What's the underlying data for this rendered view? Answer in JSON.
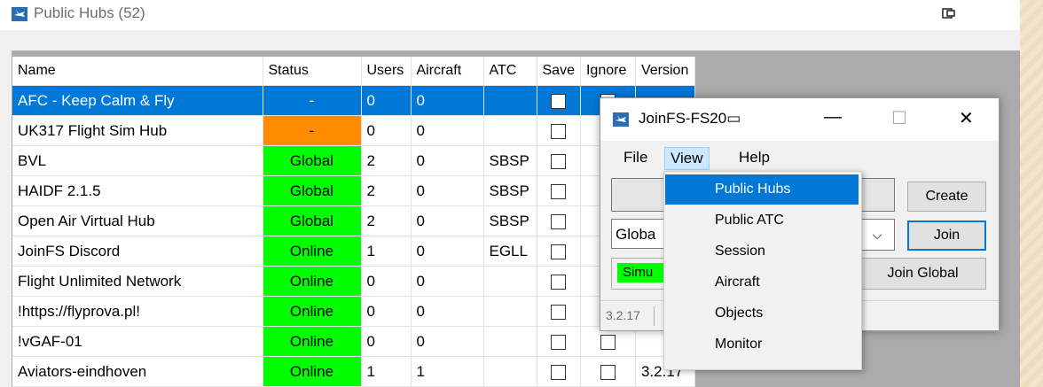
{
  "window": {
    "title": "Public Hubs (52)",
    "icon": "joinfs-plane-icon",
    "restore_icon": "restore-icon"
  },
  "grid": {
    "columns": [
      "Name",
      "Status",
      "Users",
      "Aircraft",
      "ATC",
      "Save",
      "Ignore",
      "Version"
    ],
    "rows": [
      {
        "name": "AFC - Keep Calm & Fly",
        "status": "-",
        "users": "0",
        "aircraft": "0",
        "atc": "",
        "version": "",
        "selected": true,
        "status_color": "selected"
      },
      {
        "name": "UK317 Flight Sim Hub",
        "status": "-",
        "users": "0",
        "aircraft": "0",
        "atc": "",
        "version": "",
        "selected": false,
        "status_color": "#ff8c00"
      },
      {
        "name": "BVL",
        "status": "Global",
        "users": "2",
        "aircraft": "0",
        "atc": "SBSP",
        "version": "",
        "selected": false,
        "status_color": "#00ff00"
      },
      {
        "name": "HAIDF 2.1.5",
        "status": "Global",
        "users": "2",
        "aircraft": "0",
        "atc": "SBSP",
        "version": "",
        "selected": false,
        "status_color": "#00ff00"
      },
      {
        "name": "Open Air Virtual Hub",
        "status": "Global",
        "users": "2",
        "aircraft": "0",
        "atc": "SBSP",
        "version": "",
        "selected": false,
        "status_color": "#00ff00"
      },
      {
        "name": " JoinFS Discord",
        "status": "Online",
        "users": "1",
        "aircraft": "0",
        "atc": "EGLL",
        "version": "",
        "selected": false,
        "status_color": "#00ff00"
      },
      {
        "name": " Flight Unlimited Network",
        "status": "Online",
        "users": "0",
        "aircraft": "0",
        "atc": "",
        "version": "",
        "selected": false,
        "status_color": "#00ff00"
      },
      {
        "name": "!https://flyprova.pl!",
        "status": "Online",
        "users": "0",
        "aircraft": "0",
        "atc": "",
        "version": "",
        "selected": false,
        "status_color": "#00ff00"
      },
      {
        "name": "!vGAF-01",
        "status": "Online",
        "users": "0",
        "aircraft": "0",
        "atc": "",
        "version": "",
        "selected": false,
        "status_color": "#00ff00"
      },
      {
        "name": "Aviators-eindhoven",
        "status": "Online",
        "users": "1",
        "aircraft": "1",
        "atc": "",
        "version": "3.2.17",
        "selected": false,
        "status_color": "#00ff00"
      }
    ]
  },
  "joinfs": {
    "title": "JoinFS-FS20",
    "title_glyph": "▭",
    "minimize": "—",
    "maximize": "☐",
    "close": "✕",
    "menu": [
      "File",
      "View",
      "Help"
    ],
    "active_menu": "View",
    "combo_value": "Globa",
    "sim_label": "Simu",
    "version_label": "3.2.17",
    "buttons": {
      "create": "Create",
      "join": "Join",
      "join_global": "Join Global"
    }
  },
  "view_menu": {
    "items": [
      "Public Hubs",
      "Public ATC",
      "Session",
      "Aircraft",
      "Objects",
      "Monitor"
    ],
    "highlighted": "Public Hubs"
  },
  "colors": {
    "selection": "#0078d7",
    "global_online": "#00ff00",
    "warning": "#ff8c00"
  }
}
